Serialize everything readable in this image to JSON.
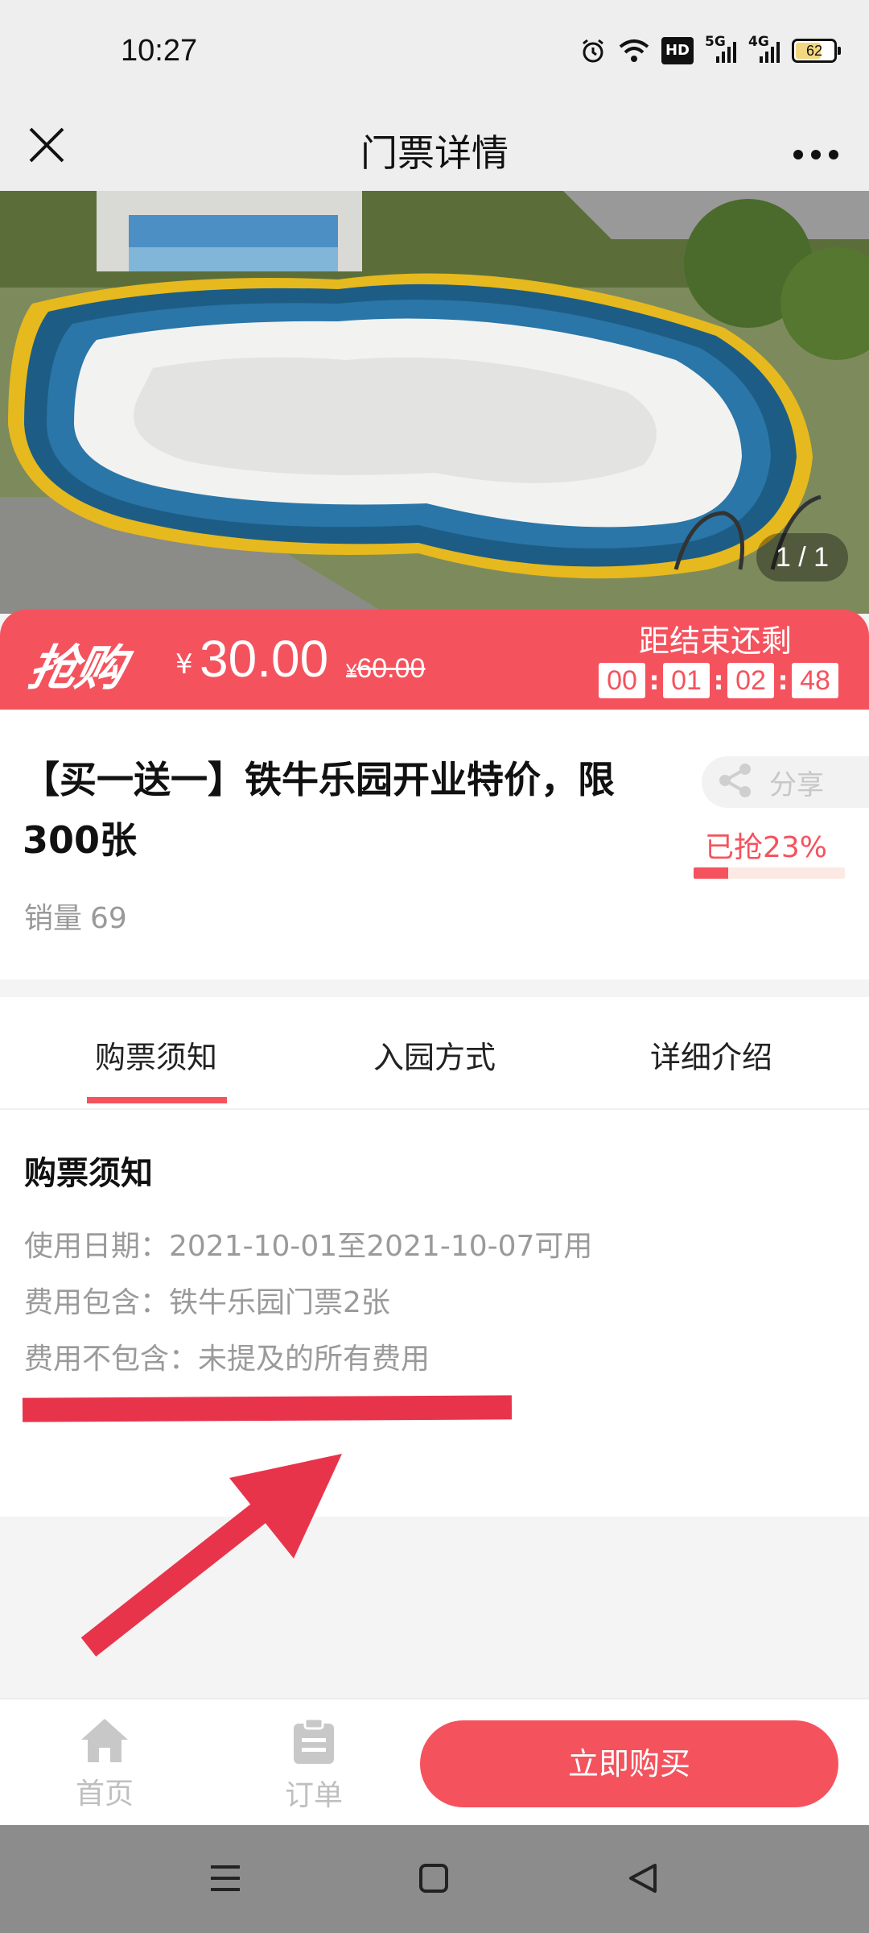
{
  "status_bar": {
    "time": "10:27",
    "hd_label": "HD",
    "net1_label": "5G",
    "net2_label": "4G",
    "battery": "62"
  },
  "nav": {
    "title": "门票详情",
    "close_icon": "close-icon",
    "more_icon": "more-icon"
  },
  "banner": {
    "page_indicator": "1 / 1"
  },
  "flash_sale": {
    "logo": "抢购",
    "currency": "¥",
    "price": "30.00",
    "original_currency": "¥",
    "original_price": "60.00",
    "countdown_label": "距结束还剩",
    "countdown": [
      "00",
      "01",
      "02",
      "48"
    ],
    "colors": {
      "accent": "#f4535e"
    }
  },
  "product": {
    "title": "【买一送一】铁牛乐园开业特价，限300张",
    "sales_label": "销量",
    "sales_value": "69",
    "share_label": "分享",
    "grabbed_text": "已抢23%",
    "grabbed_fraction": 0.23
  },
  "tabs": [
    {
      "label": "购票须知",
      "active": true
    },
    {
      "label": "入园方式",
      "active": false
    },
    {
      "label": "详细介绍",
      "active": false
    }
  ],
  "notice": {
    "heading": "购票须知",
    "lines": [
      "使用日期：2021-10-01至2021-10-07可用",
      "费用包含：铁牛乐园门票2张",
      "费用不包含：未提及的所有费用"
    ]
  },
  "bottom_bar": {
    "home_label": "首页",
    "order_label": "订单",
    "buy_label": "立即购买"
  }
}
